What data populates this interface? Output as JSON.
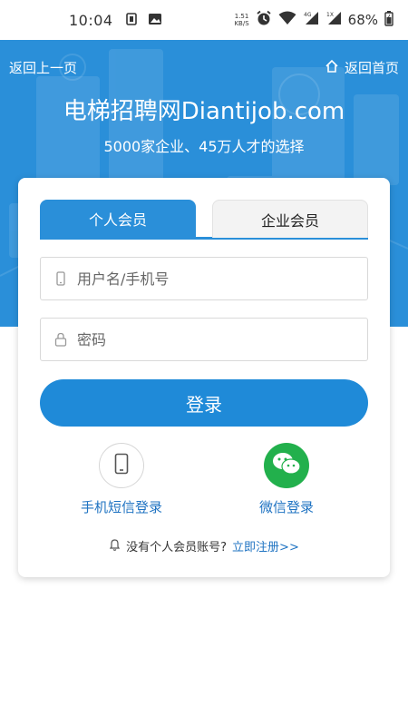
{
  "status_bar": {
    "time": "10:04",
    "net_speed_value": "1.51",
    "net_speed_unit": "KB/S",
    "battery": "68%",
    "icons": [
      "sim-icon",
      "image-icon",
      "alarm-icon",
      "wifi-icon",
      "signal-4g-icon",
      "signal-1x-icon",
      "battery-icon"
    ]
  },
  "header": {
    "back_label": "返回上一页",
    "home_label": "返回首页",
    "title": "电梯招聘网Diantijob.com",
    "subtitle": "5000家企业、45万人才的选择"
  },
  "tabs": [
    {
      "label": "个人会员",
      "active": true
    },
    {
      "label": "企业会员",
      "active": false
    }
  ],
  "form": {
    "username_placeholder": "用户名/手机号",
    "password_placeholder": "密码",
    "login_label": "登录"
  },
  "alt_login": {
    "sms_label": "手机短信登录",
    "wechat_label": "微信登录"
  },
  "register": {
    "prompt": "没有个人会员账号?",
    "link": "立即注册>>"
  },
  "colors": {
    "brand_blue": "#2a8fd9",
    "link_blue": "#1f73c2",
    "wechat_green": "#22b04c"
  }
}
